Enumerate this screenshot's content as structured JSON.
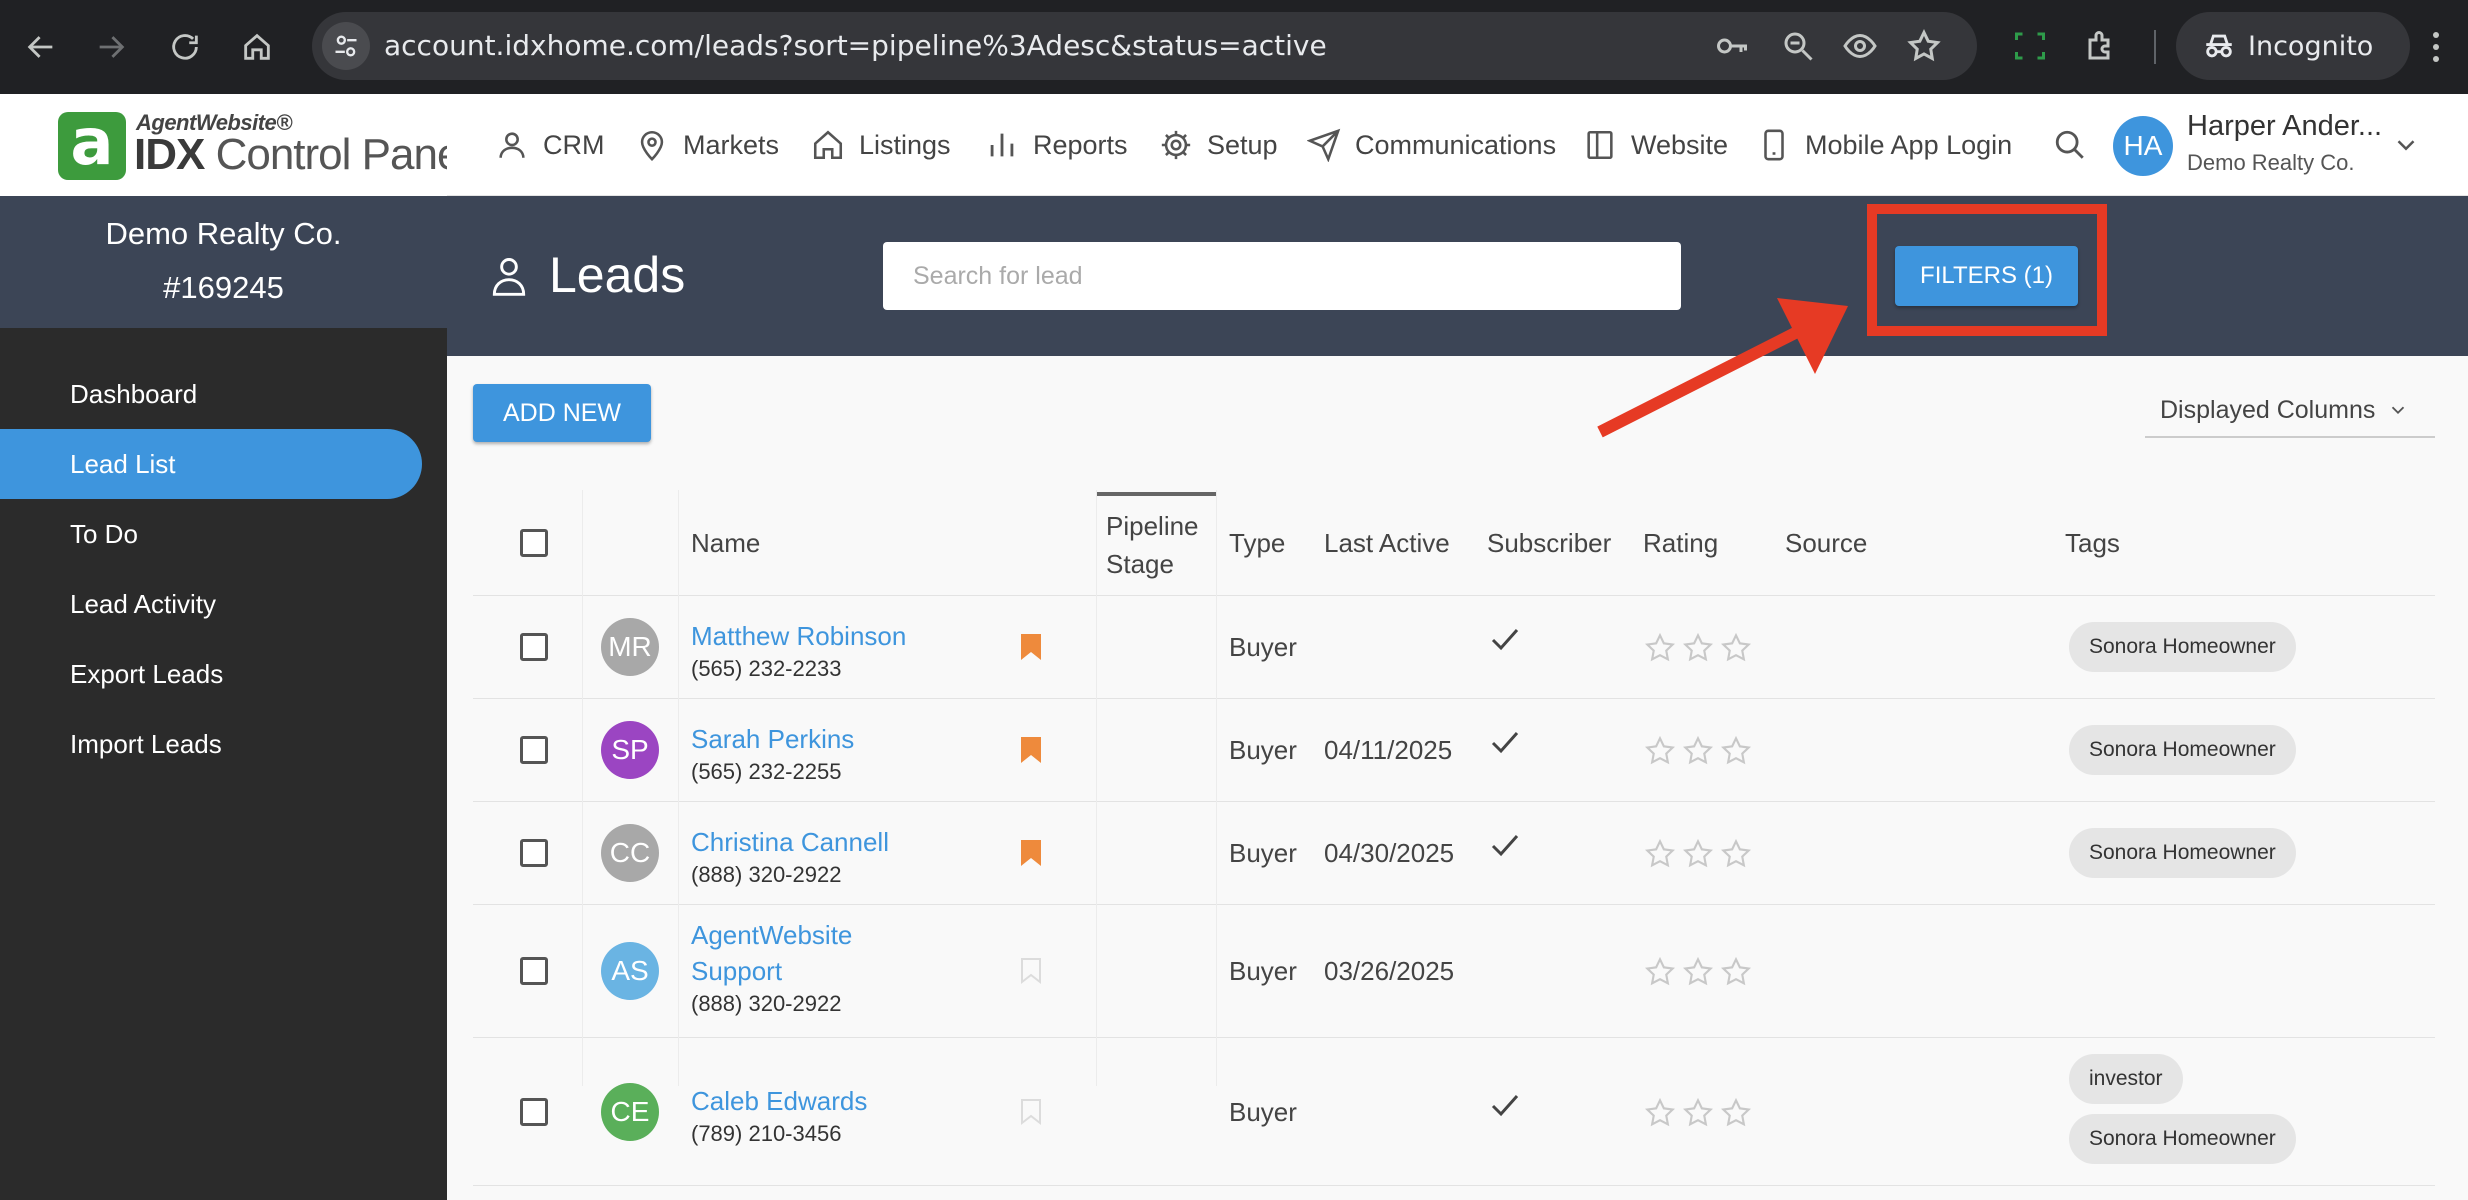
{
  "browser": {
    "url": "account.idxhome.com/leads?sort=pipeline%3Adesc&status=active",
    "incognito_label": "Incognito"
  },
  "logo": {
    "top_text": "AgentWebsite®",
    "idx_text": "IDX",
    "panel_text": " Control Panel"
  },
  "account": {
    "name": "Demo Realty Co.",
    "id": "#169245"
  },
  "sidebar": {
    "items": [
      {
        "label": "Dashboard"
      },
      {
        "label": "Lead List"
      },
      {
        "label": "To Do"
      },
      {
        "label": "Lead Activity"
      },
      {
        "label": "Export Leads"
      },
      {
        "label": "Import Leads"
      }
    ]
  },
  "topnav": {
    "items": [
      {
        "label": "CRM",
        "icon": "user-icon"
      },
      {
        "label": "Markets",
        "icon": "map-pin-icon"
      },
      {
        "label": "Listings",
        "icon": "home-icon"
      },
      {
        "label": "Reports",
        "icon": "bar-chart-icon"
      },
      {
        "label": "Setup",
        "icon": "gear-icon"
      },
      {
        "label": "Communications",
        "icon": "send-icon"
      },
      {
        "label": "Website",
        "icon": "layout-icon"
      },
      {
        "label": "Mobile App Login",
        "icon": "phone-icon"
      }
    ],
    "user": {
      "initials": "HA",
      "name": "Harper Ander...",
      "company": "Demo Realty Co."
    }
  },
  "header": {
    "title": "Leads",
    "search_placeholder": "Search for lead",
    "filters_label": "FILTERS (1)"
  },
  "toolbar": {
    "add_new_label": "ADD NEW",
    "displayed_columns_label": "Displayed Columns"
  },
  "table": {
    "columns": {
      "name": "Name",
      "pipeline_line1": "Pipeline",
      "pipeline_line2": "Stage",
      "type": "Type",
      "last_active": "Last Active",
      "subscriber": "Subscriber",
      "rating": "Rating",
      "source": "Source",
      "tags": "Tags"
    },
    "rows": [
      {
        "initials": "MR",
        "avatar_color": "#a8a8a8",
        "name": "Matthew Robinson",
        "phone": "(565) 232-2233",
        "bookmarked": true,
        "type": "Buyer",
        "last_active": "",
        "subscriber": true,
        "rating": 0,
        "tags": [
          "Sonora Homeowner"
        ]
      },
      {
        "initials": "SP",
        "avatar_color": "#9b45c2",
        "name": "Sarah Perkins",
        "phone": "(565) 232-2255",
        "bookmarked": true,
        "type": "Buyer",
        "last_active": "04/11/2025",
        "subscriber": true,
        "rating": 0,
        "tags": [
          "Sonora Homeowner"
        ]
      },
      {
        "initials": "CC",
        "avatar_color": "#a8a8a8",
        "name": "Christina Cannell",
        "phone": "(888) 320-2922",
        "bookmarked": true,
        "type": "Buyer",
        "last_active": "04/30/2025",
        "subscriber": true,
        "rating": 0,
        "tags": [
          "Sonora Homeowner"
        ]
      },
      {
        "initials": "AS",
        "avatar_color": "#6ab4e3",
        "name_line1": "AgentWebsite",
        "name_line2": "Support",
        "phone": "(888) 320-2922",
        "bookmarked": false,
        "type": "Buyer",
        "last_active": "03/26/2025",
        "subscriber": false,
        "rating": 0,
        "tags": []
      },
      {
        "initials": "CE",
        "avatar_color": "#5aaf5a",
        "name": "Caleb Edwards",
        "phone": "(789) 210-3456",
        "bookmarked": false,
        "type": "Buyer",
        "last_active": "",
        "subscriber": true,
        "rating": 0,
        "tags": [
          "investor",
          "Sonora Homeowner"
        ]
      }
    ]
  },
  "colors": {
    "accent": "#3e95dd",
    "sidebar_bg": "#2b2b2b",
    "header_bg": "#3c4556",
    "bookmark": "#ee8a3c",
    "annotation": "#e63a24"
  }
}
